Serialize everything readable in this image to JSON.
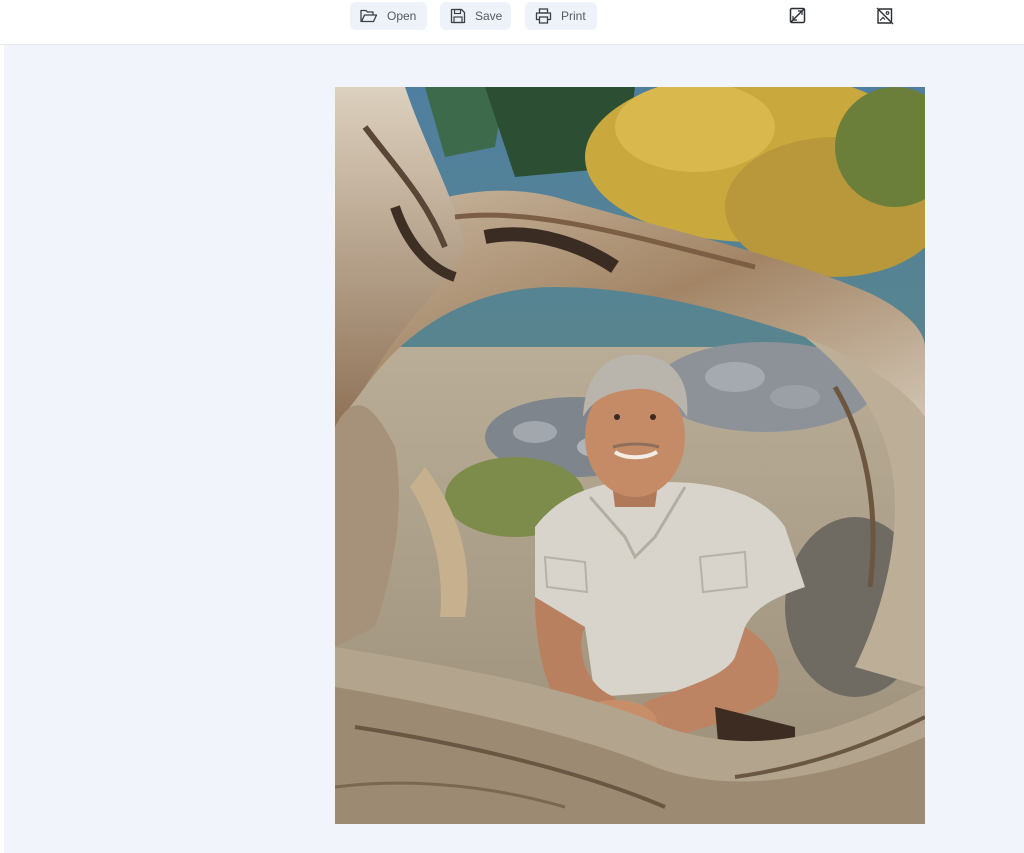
{
  "toolbar": {
    "open_label": "Open",
    "save_label": "Save",
    "print_label": "Print",
    "icons": {
      "open": "folder-open-icon",
      "save": "floppy-disk-icon",
      "print": "printer-icon",
      "right_1": "image-slash-icon",
      "right_2": "image-off-icon"
    }
  },
  "colors": {
    "workspace_bg": "#f1f4fb",
    "button_bg": "#eef2f9",
    "button_text": "#555a63"
  }
}
